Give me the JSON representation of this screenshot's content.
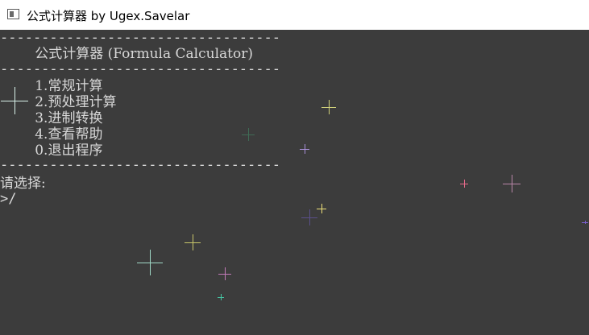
{
  "window": {
    "title": "公式计算器 by Ugex.Savelar"
  },
  "console": {
    "divider": "----------------------------------",
    "header": "        公式计算器 (Formula Calculator)",
    "menu": [
      "        1.常规计算",
      "        2.预处理计算",
      "        3.进制转换",
      "        4.查看帮助",
      "        0.退出程序"
    ],
    "prompt_label": "请选择:",
    "input_line": ">/"
  },
  "colors": {
    "console_bg": "#3c3c3c",
    "console_text": "#d8d8d8",
    "titlebar_bg": "#ffffff"
  },
  "icons": {
    "app": "console-window-icon",
    "sparkles": "sparkle-icon"
  }
}
